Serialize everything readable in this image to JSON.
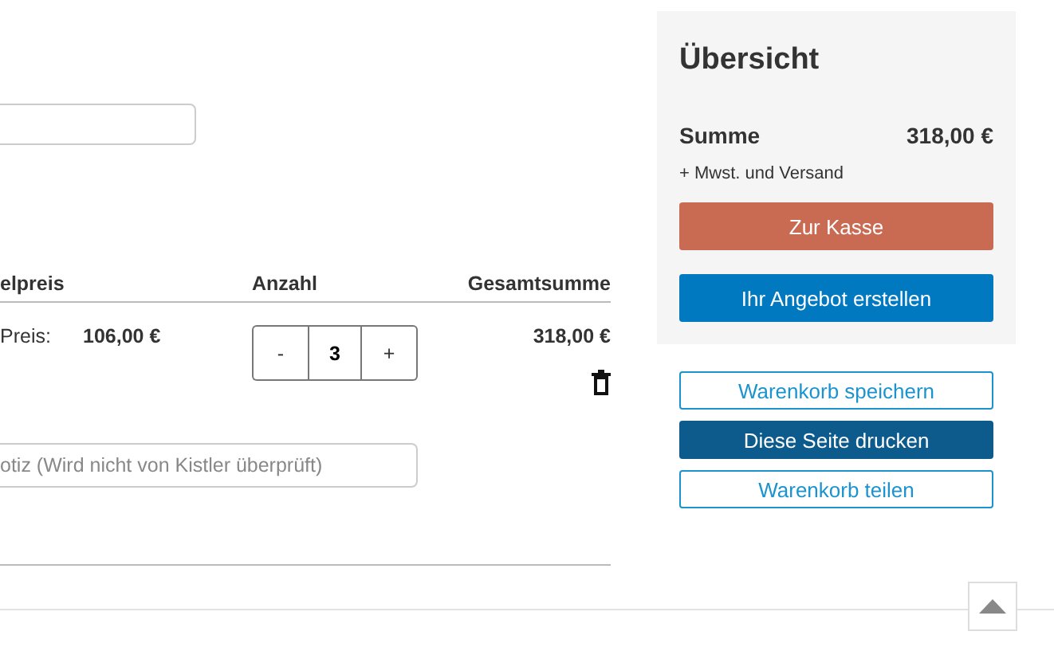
{
  "top_field": {
    "kind": "input"
  },
  "table": {
    "columns": [
      "elpreis",
      "Anzahl",
      "Gesamtsumme"
    ],
    "row": {
      "price_label": "Preis:",
      "price": "106,00 €",
      "quantity": {
        "minus": "-",
        "value": "3",
        "plus": "+"
      },
      "total": "318,00 €"
    }
  },
  "note_field": {
    "placeholder": "otiz (Wird nicht von Kistler überprüft)"
  },
  "overview": {
    "title": "Übersicht",
    "sum_label": "Summe",
    "sum": "318,00 €",
    "note": "+ Mwst. und Versand",
    "buttons": [
      {
        "label": "Zur Kasse",
        "kind": "checkout"
      },
      {
        "label": "Ihr Angebot erstellen",
        "kind": "primary"
      }
    ]
  },
  "actions": [
    {
      "label": "Warenkorb speichern",
      "kind": "outline"
    },
    {
      "label": "Diese Seite drucken",
      "kind": "dark"
    },
    {
      "label": "Warenkorb teilen",
      "kind": "outline"
    }
  ]
}
